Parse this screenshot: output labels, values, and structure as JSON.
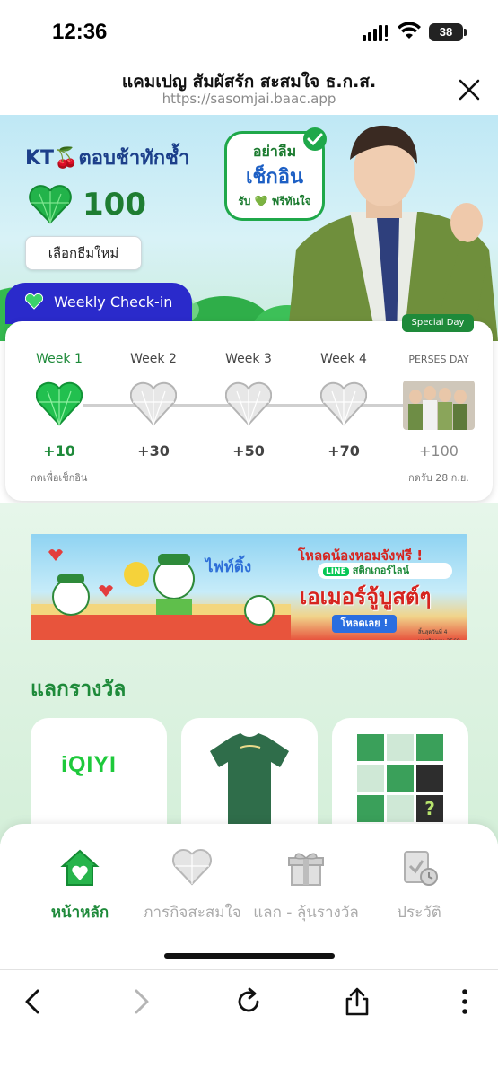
{
  "status_bar": {
    "time": "12:36",
    "battery": "38",
    "battery_percent": 38
  },
  "browser": {
    "title": "แคมเปญ สัมผัสรัก สะสมใจ ธ.ก.ส.",
    "url": "https://sasomjai.baac.app",
    "close_icon": "close-icon"
  },
  "hero": {
    "title": "KT🍒ตอบช้าทักช้ำ",
    "points": "100",
    "theme_button": "เลือกธีมใหม่",
    "bubble": {
      "line1": "อย่าลืม",
      "line2": "เช็กอิน",
      "line3": "รับ 💚 ฟรีทันใจ"
    }
  },
  "weekly": {
    "tab_label": "Weekly Check-in",
    "special_badge": "Special Day",
    "weeks": [
      {
        "label": "Week 1",
        "reward": "+10",
        "status": "active"
      },
      {
        "label": "Week 2",
        "reward": "+30",
        "status": "locked"
      },
      {
        "label": "Week 3",
        "reward": "+50",
        "status": "locked"
      },
      {
        "label": "Week 4",
        "reward": "+70",
        "status": "locked"
      },
      {
        "label": "PERSES DAY",
        "reward": "+100",
        "status": "special"
      }
    ],
    "note_left": "กดเพื่อเช็กอิน",
    "note_right": "กดรับ 28 ก.ย."
  },
  "banner": {
    "headline": "โหลดน้องหอมจังฟรี !",
    "line_tag": "LINE",
    "line_text": "สติกเกอร์ไลน์",
    "main": "เอเมอร์จู้บูสต์ๆ",
    "button": "โหลดเลย !",
    "art_text": "ไฟท์ติ้ง",
    "footnote": "สิ้นสุดวันที่ 4 พฤศจิกายน 2568"
  },
  "rewards": {
    "title": "แลกรางวัล",
    "items": [
      {
        "name": "iQIYI"
      },
      {
        "name": "green-tshirt"
      },
      {
        "name": "photo-cards"
      }
    ]
  },
  "bottom_nav": {
    "items": [
      {
        "label": "หน้าหลัก",
        "icon": "home-icon",
        "active": true
      },
      {
        "label": "ภารกิจสะสมใจ",
        "icon": "heart-mission-icon",
        "active": false
      },
      {
        "label": "แลก - ลุ้นรางวัล",
        "icon": "gift-icon",
        "active": false
      },
      {
        "label": "ประวัติ",
        "icon": "history-icon",
        "active": false
      }
    ]
  },
  "toolbar": {
    "icons": [
      "back-icon",
      "forward-icon",
      "reload-icon",
      "share-icon",
      "more-icon"
    ]
  },
  "colors": {
    "brand_green": "#1e8a3a",
    "tab_blue": "#2a2acb",
    "title_blue": "#1c3f8a",
    "inactive_gray": "#aaaaaa"
  }
}
